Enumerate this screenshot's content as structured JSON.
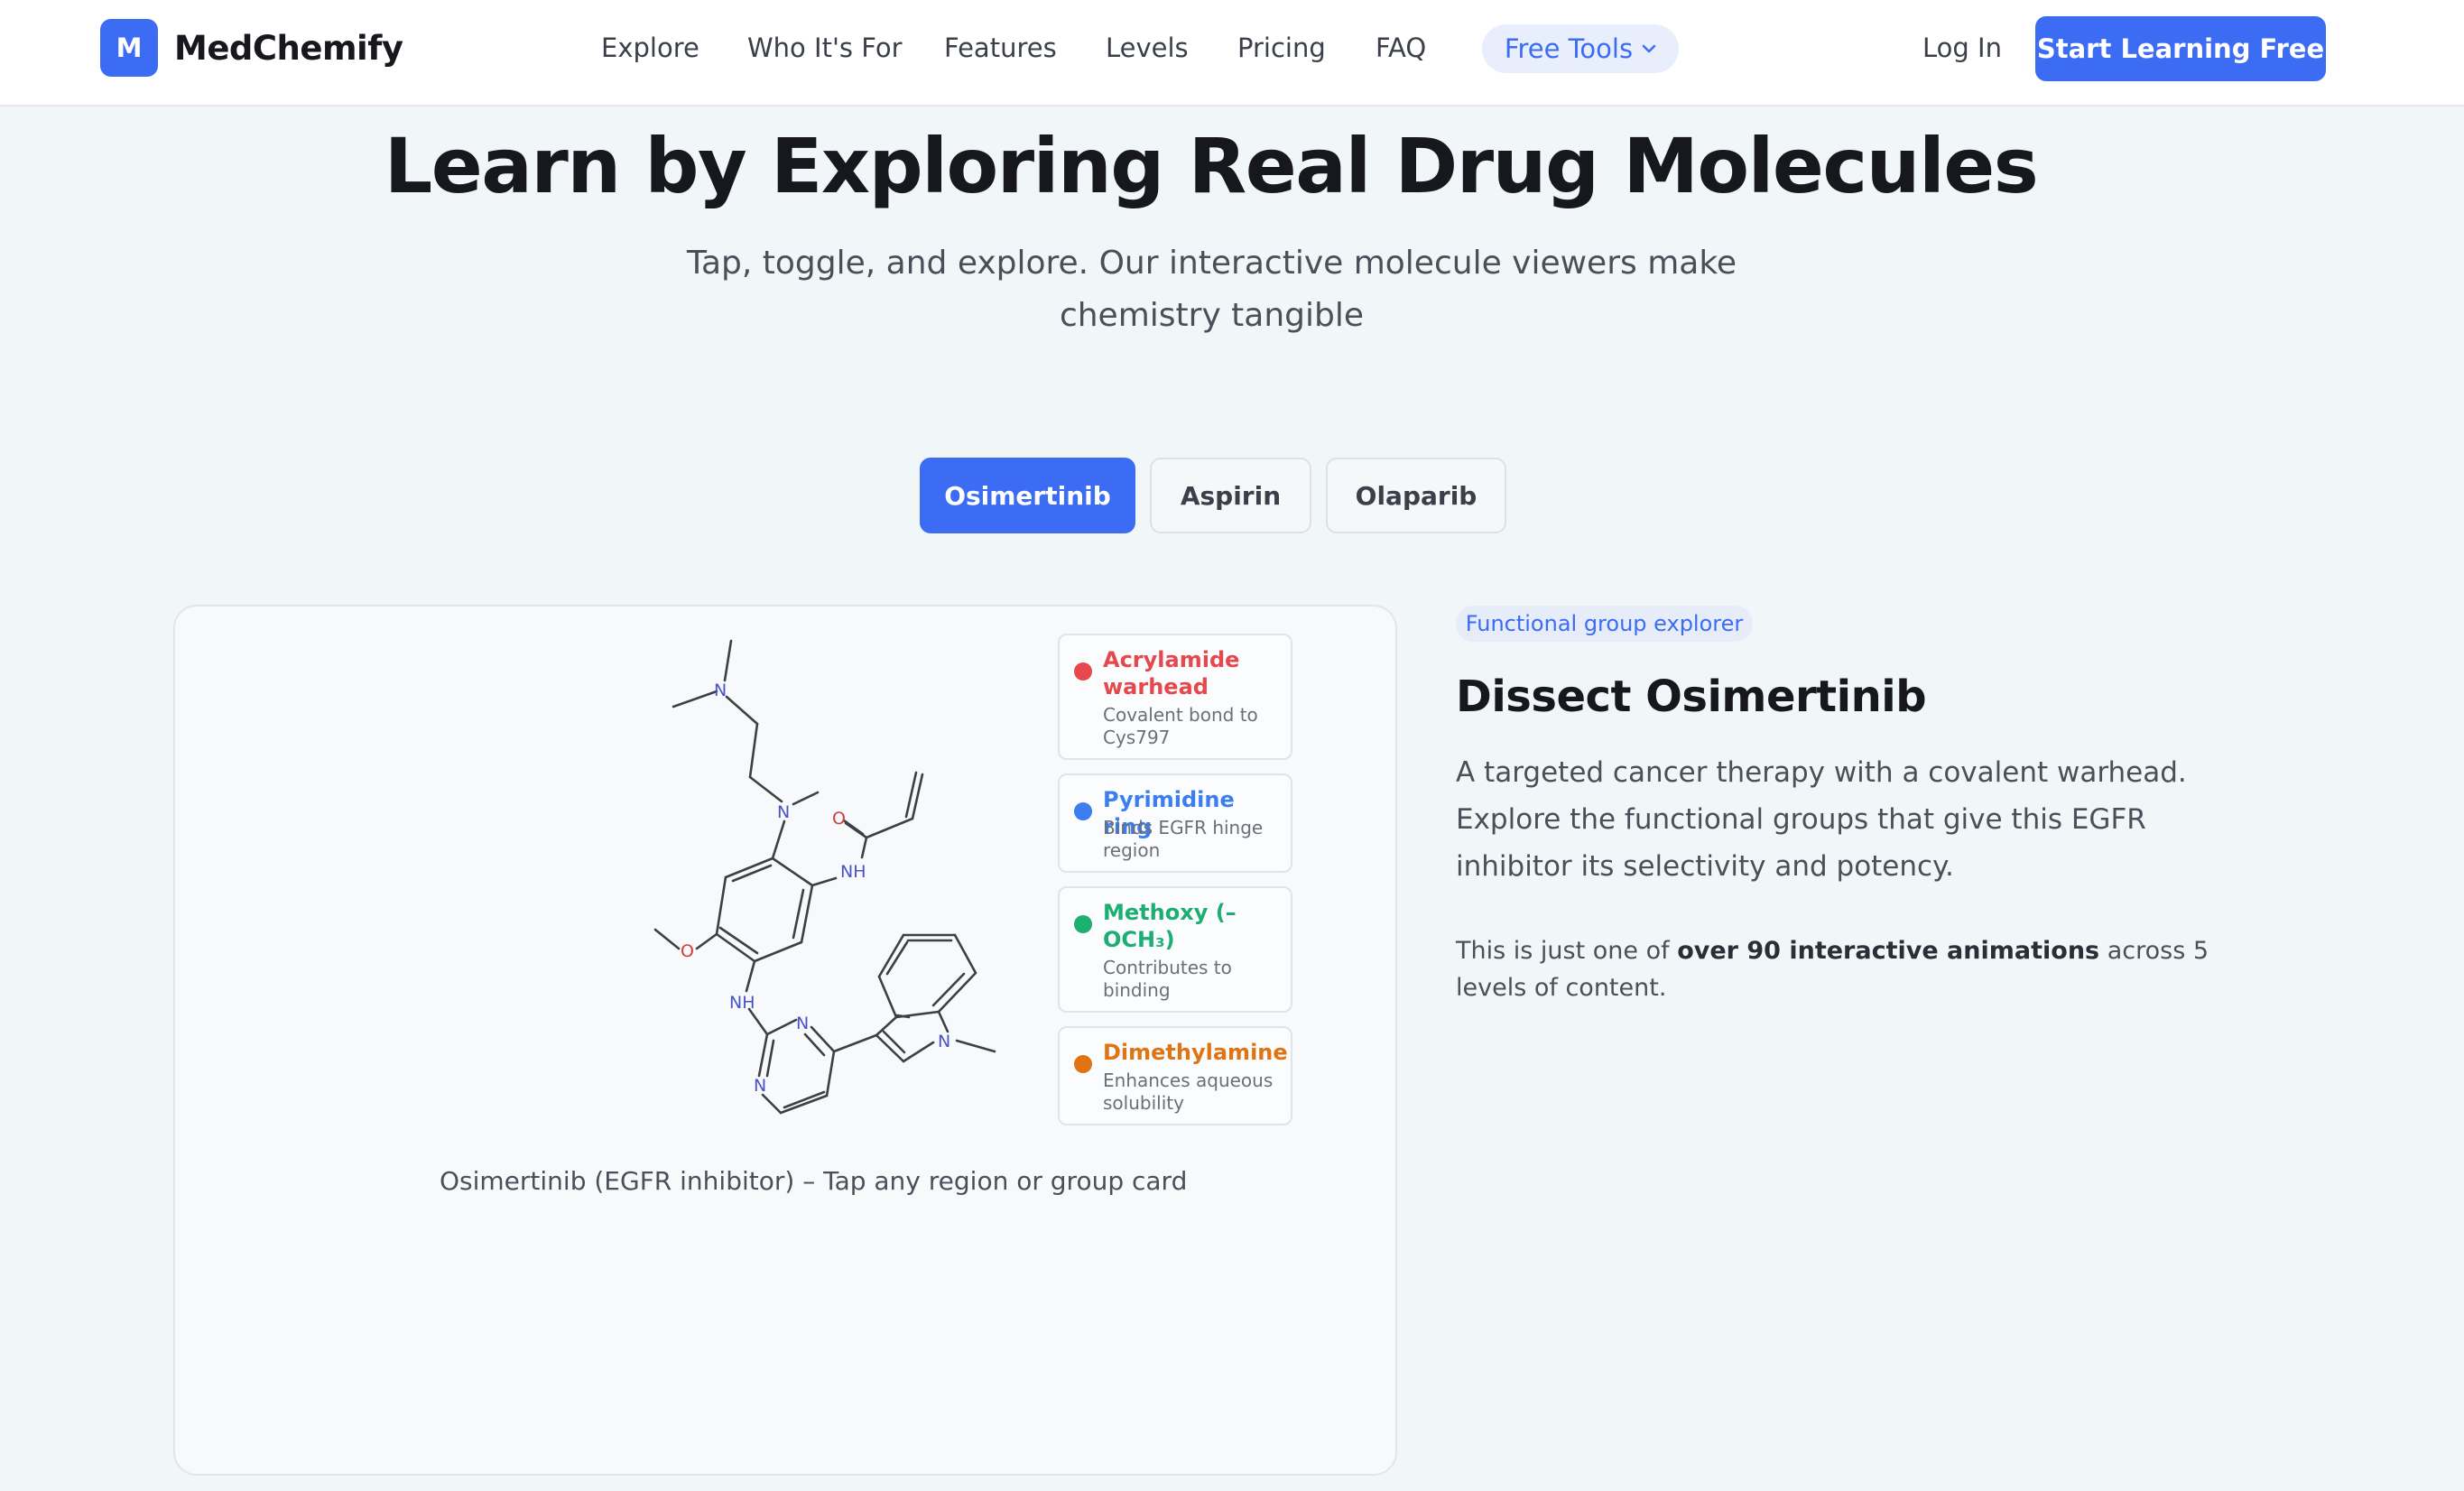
{
  "brand": {
    "logo_letter": "M",
    "name": "MedChemify",
    "accent": "#3c6cf3"
  },
  "nav": {
    "links": [
      "Explore",
      "Who It's For",
      "Features",
      "Levels",
      "Pricing",
      "FAQ"
    ],
    "tools_label": "Free Tools",
    "login_label": "Log In",
    "cta_label": "Start Learning Free"
  },
  "hero": {
    "title": "Learn by Exploring Real Drug Molecules",
    "subtitle": "Tap, toggle, and explore. Our interactive molecule viewers make chemistry tangible"
  },
  "tabs": [
    {
      "label": "Osimertinib",
      "active": true
    },
    {
      "label": "Aspirin",
      "active": false
    },
    {
      "label": "Olaparib",
      "active": false
    }
  ],
  "molecule": {
    "atoms": {
      "N": "N",
      "NH": "NH",
      "O": "O"
    },
    "caption": "Osimertinib (EGFR inhibitor) – Tap any region or group card"
  },
  "groups": [
    {
      "name": "Acrylamide warhead",
      "desc": "Covalent bond to Cys797",
      "color": "#e5484d"
    },
    {
      "name": "Pyrimidine ring",
      "desc": "Binds EGFR hinge region",
      "color": "#3c7ef0"
    },
    {
      "name": "Methoxy (–OCH₃)",
      "desc": "Contributes to binding",
      "color": "#1cae72"
    },
    {
      "name": "Dimethylamine",
      "desc": "Enhances aqueous solubility",
      "color": "#e07414"
    }
  ],
  "explorer": {
    "badge": "Functional group explorer",
    "title": "Dissect Osimertinib",
    "description": "A targeted cancer therapy with a covalent warhead. Explore the functional groups that give this EGFR inhibitor its selectivity and potency.",
    "note_prefix": "This is just one of",
    "note_bold": "over 90 interactive animations",
    "note_suffix": "across 5 levels of content."
  }
}
